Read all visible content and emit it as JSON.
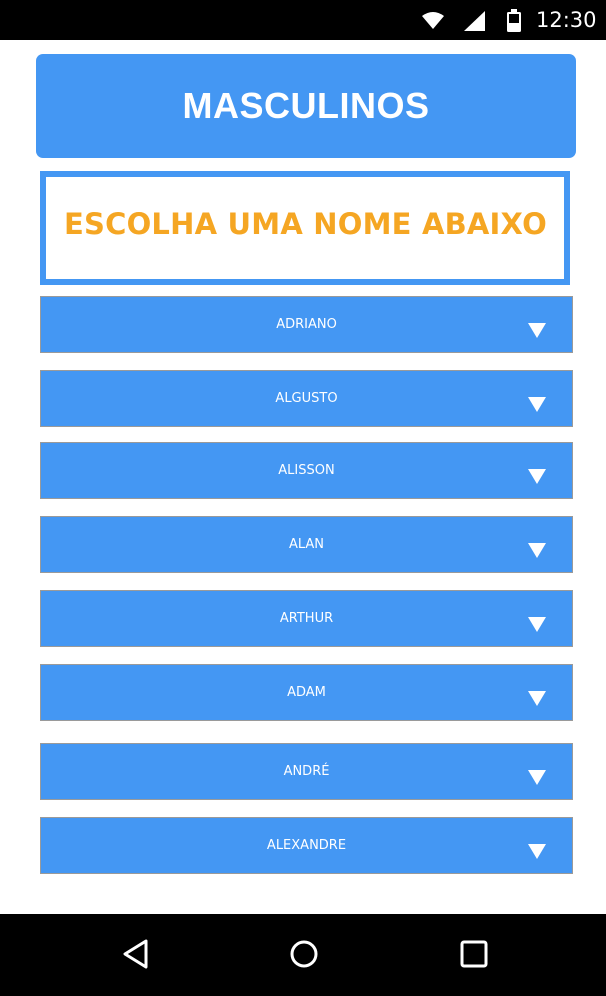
{
  "status_bar": {
    "time": "12:30",
    "icons": [
      "wifi-icon",
      "cellular-signal-icon",
      "battery-icon"
    ]
  },
  "header": {
    "title": "MASCULINOS"
  },
  "prompt": {
    "text": "ESCOLHA UMA NOME ABAIXO"
  },
  "names": [
    {
      "label": "ADRIANO"
    },
    {
      "label": "ALGUSTO"
    },
    {
      "label": "ALISSON"
    },
    {
      "label": "ALAN"
    },
    {
      "label": "ARTHUR"
    },
    {
      "label": "ADAM"
    },
    {
      "label": "ANDRÉ"
    },
    {
      "label": "ALEXANDRE"
    }
  ],
  "nav_bar": {
    "buttons": [
      "back-icon",
      "home-icon",
      "recents-icon"
    ]
  },
  "colors": {
    "accent": "#4497f3",
    "prompt_text": "#f5a623",
    "system_bars": "#000000"
  }
}
